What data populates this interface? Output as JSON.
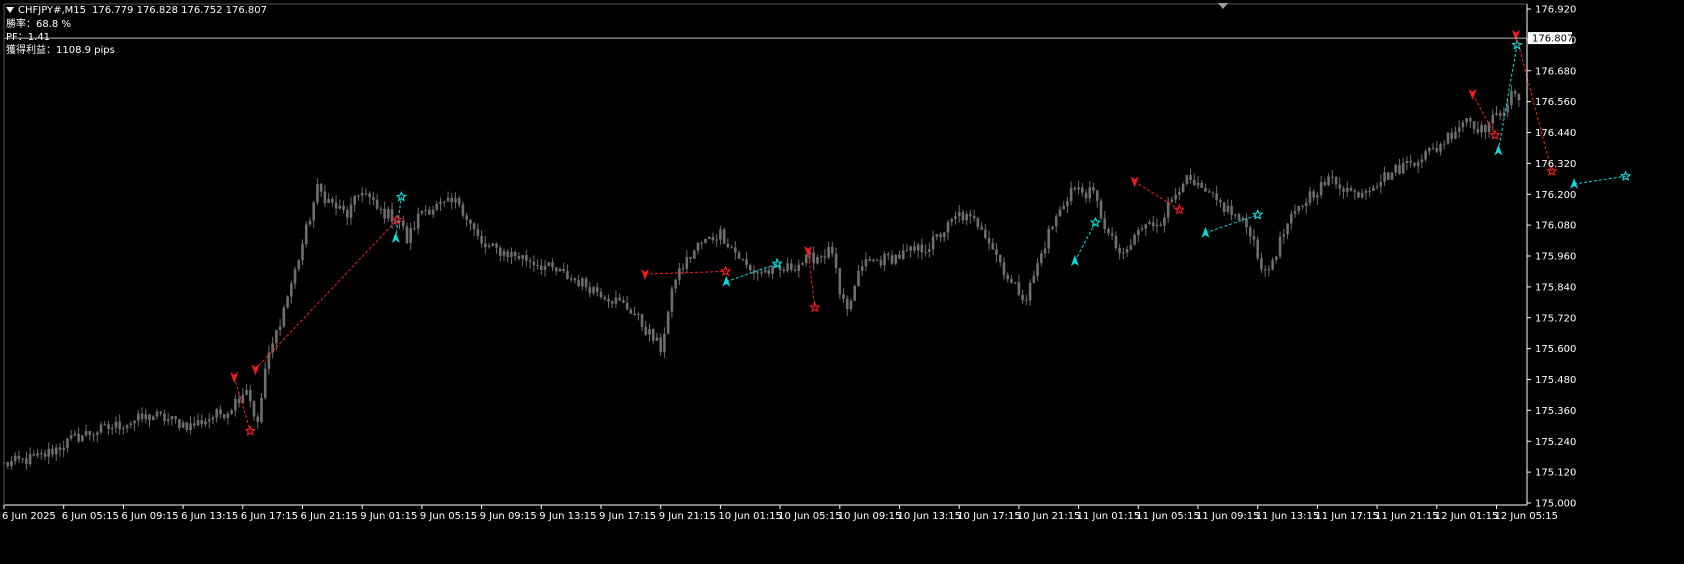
{
  "header": {
    "symbol": "CHFJPY#,M15",
    "ohlc": "176.779 176.828 176.752 176.807",
    "win_rate_label": "勝率：68.8 %",
    "pf_label": "PF：1.41",
    "profit_label": "獲得利益：1108.9 pips"
  },
  "colors": {
    "background": "#000000",
    "candle": "#6e6e6e",
    "axis": "#ffffff",
    "sell_trade": "#ff1a1a",
    "buy_trade": "#00e0e0",
    "current_price_line": "#bdbdbd"
  },
  "current_price": {
    "value": 176.807,
    "label": "176.807"
  },
  "chart_data": {
    "type": "candlestick",
    "ylim": [
      175.0,
      176.92
    ],
    "yticks": [
      "176.920",
      "176.800",
      "176.680",
      "176.560",
      "176.440",
      "176.320",
      "176.200",
      "176.080",
      "175.960",
      "175.840",
      "175.720",
      "175.600",
      "175.480",
      "175.360",
      "175.240",
      "175.120",
      "175.000"
    ],
    "xticks": [
      "6 Jun 2025",
      "6 Jun 05:15",
      "6 Jun 09:15",
      "6 Jun 13:15",
      "6 Jun 17:15",
      "6 Jun 21:15",
      "9 Jun 01:15",
      "9 Jun 05:15",
      "9 Jun 09:15",
      "9 Jun 13:15",
      "9 Jun 17:15",
      "9 Jun 21:15",
      "10 Jun 01:15",
      "10 Jun 05:15",
      "10 Jun 09:15",
      "10 Jun 13:15",
      "10 Jun 17:15",
      "10 Jun 21:15",
      "11 Jun 01:15",
      "11 Jun 05:15",
      "11 Jun 09:15",
      "11 Jun 13:15",
      "11 Jun 17:15",
      "11 Jun 21:15",
      "12 Jun 01:15",
      "12 Jun 05:15"
    ],
    "bars_per_tick": 16,
    "price_anchors": [
      [
        0,
        175.15
      ],
      [
        10,
        175.18
      ],
      [
        20,
        175.26
      ],
      [
        30,
        175.3
      ],
      [
        40,
        175.34
      ],
      [
        50,
        175.3
      ],
      [
        60,
        175.36
      ],
      [
        65,
        175.45
      ],
      [
        68,
        175.3
      ],
      [
        70,
        175.52
      ],
      [
        78,
        175.9
      ],
      [
        84,
        176.22
      ],
      [
        88,
        176.16
      ],
      [
        92,
        176.12
      ],
      [
        96,
        176.22
      ],
      [
        100,
        176.14
      ],
      [
        106,
        176.1
      ],
      [
        108,
        176.02
      ],
      [
        112,
        176.14
      ],
      [
        122,
        176.17
      ],
      [
        128,
        176.0
      ],
      [
        140,
        175.95
      ],
      [
        148,
        175.9
      ],
      [
        160,
        175.82
      ],
      [
        168,
        175.75
      ],
      [
        176,
        175.6
      ],
      [
        180,
        175.88
      ],
      [
        186,
        176.0
      ],
      [
        192,
        176.05
      ],
      [
        200,
        175.9
      ],
      [
        208,
        175.9
      ],
      [
        216,
        175.95
      ],
      [
        222,
        175.98
      ],
      [
        224,
        175.8
      ],
      [
        226,
        175.74
      ],
      [
        230,
        175.93
      ],
      [
        240,
        175.96
      ],
      [
        248,
        176.0
      ],
      [
        256,
        176.12
      ],
      [
        262,
        176.08
      ],
      [
        270,
        175.85
      ],
      [
        274,
        175.8
      ],
      [
        280,
        176.05
      ],
      [
        286,
        176.22
      ],
      [
        292,
        176.2
      ],
      [
        296,
        176.04
      ],
      [
        300,
        175.95
      ],
      [
        304,
        176.06
      ],
      [
        310,
        176.1
      ],
      [
        316,
        176.26
      ],
      [
        322,
        176.2
      ],
      [
        328,
        176.14
      ],
      [
        334,
        176.06
      ],
      [
        338,
        175.88
      ],
      [
        344,
        176.08
      ],
      [
        350,
        176.2
      ],
      [
        356,
        176.26
      ],
      [
        362,
        176.2
      ],
      [
        368,
        176.25
      ],
      [
        376,
        176.32
      ],
      [
        384,
        176.38
      ],
      [
        392,
        176.5
      ],
      [
        396,
        176.45
      ],
      [
        400,
        176.5
      ],
      [
        404,
        176.58
      ],
      [
        410,
        176.56
      ],
      [
        414,
        176.4
      ],
      [
        416,
        176.25
      ],
      [
        418,
        176.72
      ],
      [
        420,
        176.8
      ],
      [
        422,
        176.62
      ],
      [
        426,
        176.55
      ],
      [
        430,
        176.3
      ],
      [
        434,
        176.3
      ],
      [
        440,
        176.22
      ],
      [
        444,
        176.1
      ],
      [
        448,
        176.16
      ],
      [
        456,
        176.14
      ],
      [
        460,
        176.22
      ],
      [
        464,
        176.12
      ],
      [
        470,
        176.16
      ],
      [
        478,
        176.2
      ],
      [
        484,
        176.24
      ],
      [
        490,
        176.26
      ]
    ],
    "trades": [
      {
        "dir": "sell",
        "entry": [
          61.7,
          175.49
        ],
        "exit": [
          66.0,
          175.28
        ]
      },
      {
        "dir": "sell",
        "entry": [
          67.4,
          175.52
        ],
        "exit": [
          105.3,
          176.1
        ]
      },
      {
        "dir": "buy",
        "entry": [
          105.0,
          176.03
        ],
        "exit": [
          106.5,
          176.19
        ]
      },
      {
        "dir": "sell",
        "entry": [
          171.8,
          175.89
        ],
        "exit": [
          193.4,
          175.9
        ]
      },
      {
        "dir": "buy",
        "entry": [
          193.6,
          175.86
        ],
        "exit": [
          207.2,
          175.93
        ]
      },
      {
        "dir": "sell",
        "entry": [
          215.5,
          175.98
        ],
        "exit": [
          217.3,
          175.76
        ]
      },
      {
        "dir": "buy",
        "entry": [
          287.0,
          175.94
        ],
        "exit": [
          292.5,
          176.09
        ]
      },
      {
        "dir": "sell",
        "entry": [
          303.0,
          176.25
        ],
        "exit": [
          315.0,
          176.14
        ]
      },
      {
        "dir": "buy",
        "entry": [
          322.0,
          176.05
        ],
        "exit": [
          336.0,
          176.12
        ]
      },
      {
        "dir": "sell",
        "entry": [
          393.6,
          176.59
        ],
        "exit": [
          399.6,
          176.43
        ]
      },
      {
        "dir": "buy",
        "entry": [
          400.5,
          176.37
        ],
        "exit": [
          405.5,
          176.78
        ]
      },
      {
        "dir": "sell",
        "entry": [
          405.2,
          176.82
        ],
        "exit": [
          414.8,
          176.29
        ]
      },
      {
        "dir": "buy",
        "entry": [
          420.8,
          176.24
        ],
        "exit": [
          434.6,
          176.27
        ]
      }
    ]
  }
}
